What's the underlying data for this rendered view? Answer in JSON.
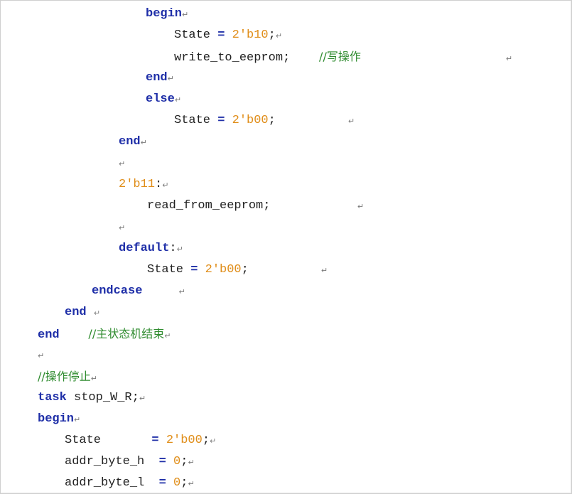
{
  "para_mark": "↵",
  "lines": [
    {
      "tokens": [
        {
          "t": "begin",
          "k": "kw"
        },
        {
          "t": "↵",
          "k": "pm"
        }
      ]
    },
    {
      "tokens": [
        {
          "t": "State ",
          "k": "pl"
        },
        {
          "t": "=",
          "k": "op"
        },
        {
          "t": " ",
          "k": "pl"
        },
        {
          "t": "2'b10",
          "k": "num"
        },
        {
          "t": ";",
          "k": "pl"
        },
        {
          "t": "↵",
          "k": "pm"
        }
      ]
    },
    {
      "tokens": [
        {
          "t": "write_to_eeprom;",
          "k": "pl"
        },
        {
          "t": "    ",
          "k": "pl"
        },
        {
          "t": "//写操作",
          "k": "cm"
        },
        {
          "t": "                    ",
          "k": "pl"
        },
        {
          "t": "↵",
          "k": "pm"
        }
      ]
    },
    {
      "tokens": [
        {
          "t": "end",
          "k": "kw"
        },
        {
          "t": "↵",
          "k": "pm"
        }
      ]
    },
    {
      "tokens": [
        {
          "t": "else",
          "k": "kw"
        },
        {
          "t": "↵",
          "k": "pm"
        }
      ]
    },
    {
      "tokens": [
        {
          "t": "State ",
          "k": "pl"
        },
        {
          "t": "=",
          "k": "op"
        },
        {
          "t": " ",
          "k": "pl"
        },
        {
          "t": "2'b00",
          "k": "num"
        },
        {
          "t": ";",
          "k": "pl"
        },
        {
          "t": "          ",
          "k": "pl"
        },
        {
          "t": "↵",
          "k": "pm"
        }
      ]
    },
    {
      "tokens": [
        {
          "t": "end",
          "k": "kw"
        },
        {
          "t": "↵",
          "k": "pm"
        }
      ]
    },
    {
      "tokens": [
        {
          "t": "↵",
          "k": "pm"
        }
      ]
    },
    {
      "tokens": [
        {
          "t": "2'b11",
          "k": "num"
        },
        {
          "t": ":",
          "k": "pl"
        },
        {
          "t": "↵",
          "k": "pm"
        }
      ]
    },
    {
      "tokens": [
        {
          "t": "read_from_eeprom;",
          "k": "pl"
        },
        {
          "t": "            ",
          "k": "pl"
        },
        {
          "t": "↵",
          "k": "pm"
        }
      ]
    },
    {
      "tokens": [
        {
          "t": "↵",
          "k": "pm"
        }
      ]
    },
    {
      "tokens": [
        {
          "t": "default",
          "k": "kw"
        },
        {
          "t": ":",
          "k": "pl"
        },
        {
          "t": "↵",
          "k": "pm"
        }
      ]
    },
    {
      "tokens": [
        {
          "t": "State ",
          "k": "pl"
        },
        {
          "t": "=",
          "k": "op"
        },
        {
          "t": " ",
          "k": "pl"
        },
        {
          "t": "2'b00",
          "k": "num"
        },
        {
          "t": ";",
          "k": "pl"
        },
        {
          "t": "          ",
          "k": "pl"
        },
        {
          "t": "↵",
          "k": "pm"
        }
      ]
    },
    {
      "tokens": [
        {
          "t": "endcase",
          "k": "kw"
        },
        {
          "t": "     ",
          "k": "pl"
        },
        {
          "t": "↵",
          "k": "pm"
        }
      ]
    },
    {
      "tokens": [
        {
          "t": "end",
          "k": "kw"
        },
        {
          "t": " ",
          "k": "pl"
        },
        {
          "t": "↵",
          "k": "pm"
        }
      ]
    },
    {
      "tokens": [
        {
          "t": "end",
          "k": "kw"
        },
        {
          "t": "    ",
          "k": "pl"
        },
        {
          "t": "//主状态机结束",
          "k": "cm"
        },
        {
          "t": "↵",
          "k": "pm"
        }
      ]
    },
    {
      "tokens": [
        {
          "t": "↵",
          "k": "pm"
        }
      ]
    },
    {
      "tokens": [
        {
          "t": "//操作停止",
          "k": "cm"
        },
        {
          "t": "↵",
          "k": "pm"
        }
      ]
    },
    {
      "tokens": [
        {
          "t": "task",
          "k": "kw"
        },
        {
          "t": " stop_W_R;",
          "k": "pl"
        },
        {
          "t": "↵",
          "k": "pm"
        }
      ]
    },
    {
      "tokens": [
        {
          "t": "begin",
          "k": "kw"
        },
        {
          "t": "↵",
          "k": "pm"
        }
      ]
    },
    {
      "tokens": [
        {
          "t": "State       ",
          "k": "pl"
        },
        {
          "t": "=",
          "k": "op"
        },
        {
          "t": " ",
          "k": "pl"
        },
        {
          "t": "2'b00",
          "k": "num"
        },
        {
          "t": ";",
          "k": "pl"
        },
        {
          "t": "↵",
          "k": "pm"
        }
      ]
    },
    {
      "tokens": [
        {
          "t": "addr_byte_h  ",
          "k": "pl"
        },
        {
          "t": "=",
          "k": "op"
        },
        {
          "t": " ",
          "k": "pl"
        },
        {
          "t": "0",
          "k": "num"
        },
        {
          "t": ";",
          "k": "pl"
        },
        {
          "t": "↵",
          "k": "pm"
        }
      ]
    },
    {
      "tokens": [
        {
          "t": "addr_byte_l  ",
          "k": "pl"
        },
        {
          "t": "=",
          "k": "op"
        },
        {
          "t": " ",
          "k": "pl"
        },
        {
          "t": "0",
          "k": "num"
        },
        {
          "t": ";",
          "k": "pl"
        },
        {
          "t": "↵",
          "k": "pm"
        }
      ]
    }
  ]
}
